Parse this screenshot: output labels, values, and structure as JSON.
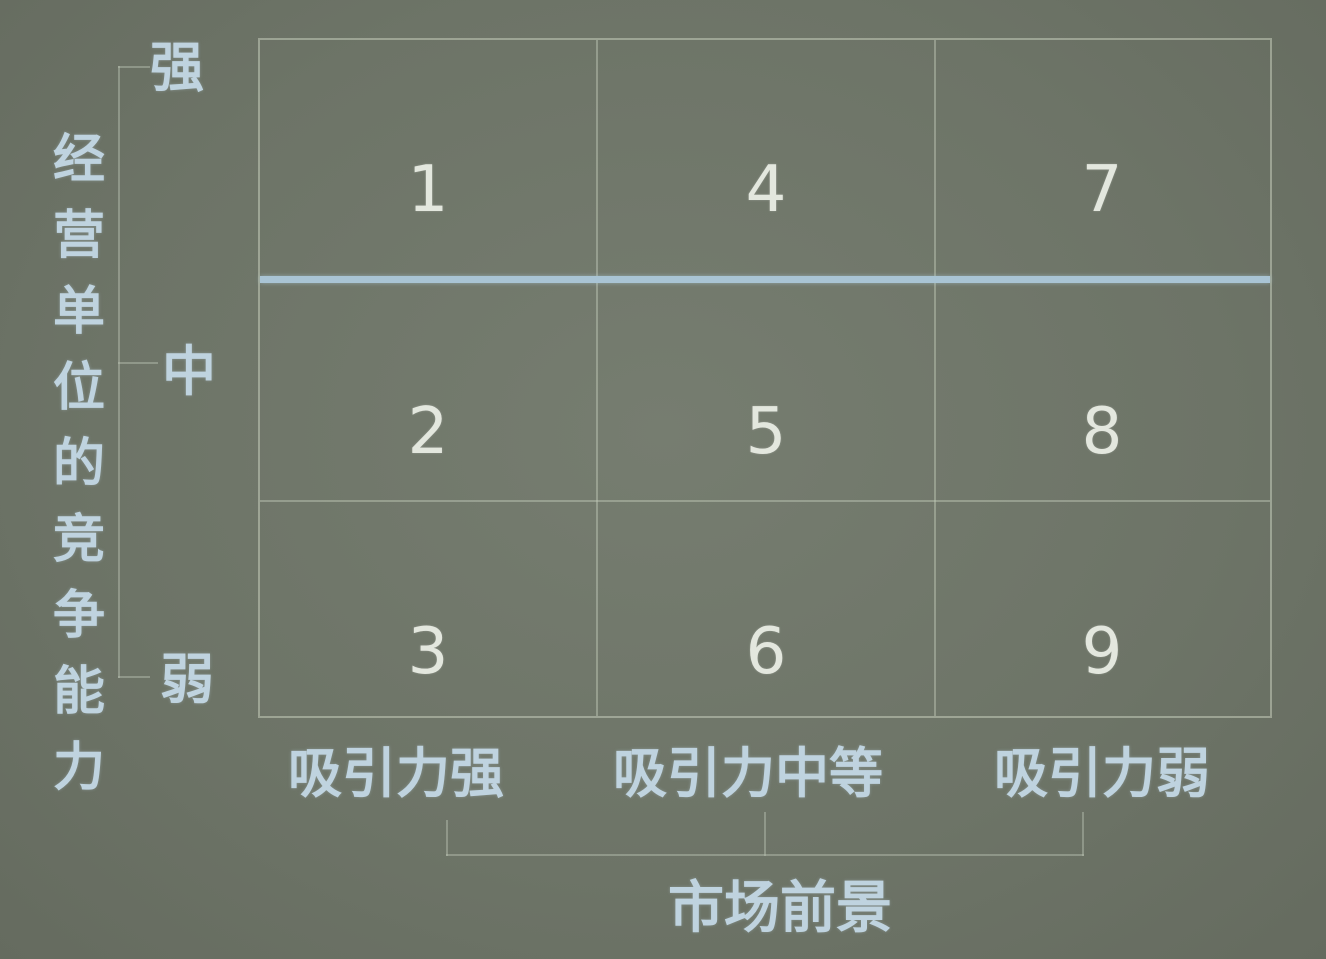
{
  "y_axis": {
    "title_chars": [
      "经",
      "营",
      "单",
      "位",
      "的",
      "竞",
      "争",
      "能",
      "力"
    ],
    "levels": [
      "强",
      "中",
      "弱"
    ]
  },
  "x_axis": {
    "title": "市场前景",
    "levels": [
      "吸引力强",
      "吸引力中等",
      "吸引力弱"
    ]
  },
  "grid": {
    "rows": [
      [
        "1",
        "4",
        "7"
      ],
      [
        "2",
        "5",
        "8"
      ],
      [
        "3",
        "6",
        "9"
      ]
    ]
  },
  "colors": {
    "background": "#6f7669",
    "label_text": "#bfd3df",
    "number_text": "#e3e7de",
    "divider_highlight": "#a9c4d4"
  }
}
